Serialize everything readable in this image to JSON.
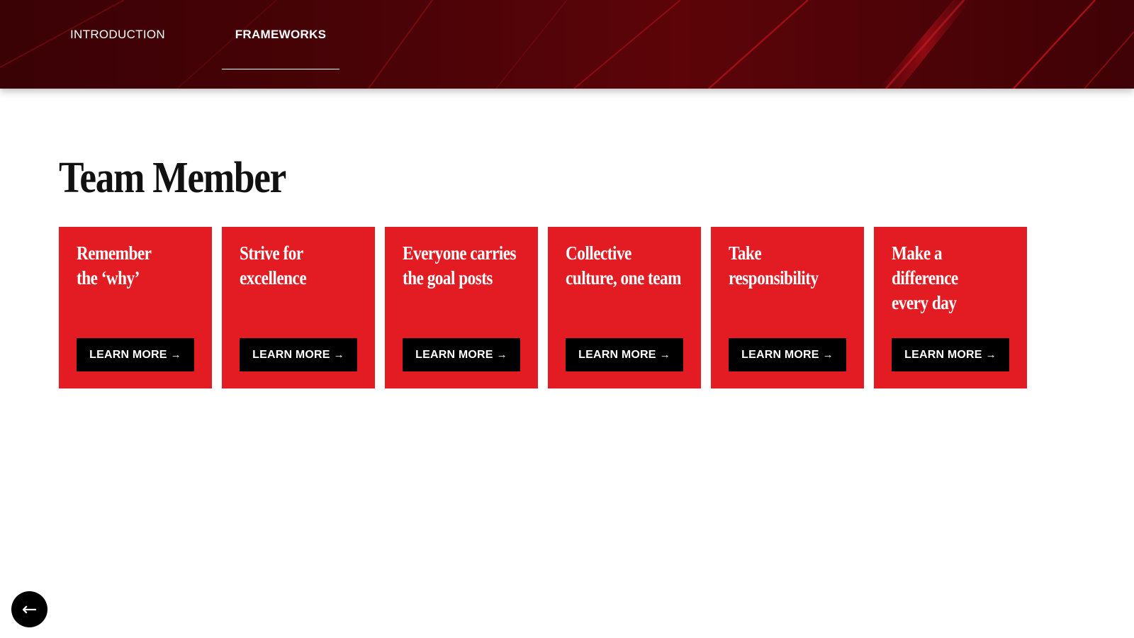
{
  "nav": {
    "tabs": [
      {
        "label": "INTRODUCTION",
        "active": false
      },
      {
        "label": "FRAMEWORKS",
        "active": true
      }
    ]
  },
  "main": {
    "title": "Team Member",
    "cards": [
      {
        "title": "Remember\nthe ‘why’",
        "button_label": "LEARN MORE",
        "button_icon": "arrow-right-icon"
      },
      {
        "title": "Strive for\nexcellence",
        "button_label": "LEARN MORE",
        "button_icon": "arrow-right-icon"
      },
      {
        "title": "Everyone carries\nthe goal posts",
        "button_label": "LEARN MORE",
        "button_icon": "arrow-right-icon"
      },
      {
        "title": "Collective\nculture, one team",
        "button_label": "LEARN MORE",
        "button_icon": "arrow-right-icon"
      },
      {
        "title": "Take\nresponsibility",
        "button_label": "LEARN MORE",
        "button_icon": "arrow-right-icon"
      },
      {
        "title": "Make a\ndifference\nevery day",
        "button_label": "LEARN MORE",
        "button_icon": "arrow-right-icon"
      }
    ]
  },
  "back_button": {
    "icon": "arrow-left-icon"
  },
  "colors": {
    "header_bg": "#4a0307",
    "card_bg": "#e31b23",
    "button_bg": "#000000",
    "text_dark": "#111111"
  }
}
